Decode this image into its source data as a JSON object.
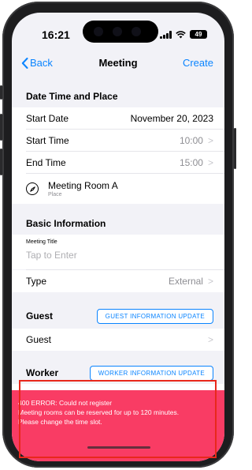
{
  "status_bar": {
    "time": "16:21",
    "battery": "49"
  },
  "nav": {
    "back_label": "Back",
    "title": "Meeting",
    "create_label": "Create"
  },
  "sections": {
    "datetime": {
      "header": "Date Time and Place",
      "start_date": {
        "label": "Start Date",
        "value": "November 20, 2023"
      },
      "start_time": {
        "label": "Start Time",
        "value": "10:00"
      },
      "end_time": {
        "label": "End Time",
        "value": "15:00"
      },
      "place": {
        "value": "Meeting Room A",
        "caption": "Place"
      }
    },
    "basic": {
      "header": "Basic Information",
      "meeting_title": {
        "label": "Meeting Title",
        "placeholder": "Tap to Enter"
      },
      "type": {
        "label": "Type",
        "value": "External"
      }
    },
    "guest": {
      "header": "Guest",
      "update_button": "GUEST INFORMATION UPDATE",
      "row_label": "Guest"
    },
    "worker": {
      "header": "Worker",
      "update_button": "WORKER INFORMATION UPDATE"
    }
  },
  "error_toast": {
    "line1": "400 ERROR: Could not register",
    "line2": "Meeting rooms can be reserved for up to 120 minutes.",
    "line3": "Please change the time slot."
  },
  "colors": {
    "accent": "#0a84ff",
    "error": "#f93c64",
    "highlight_frame": "#e8281b"
  }
}
